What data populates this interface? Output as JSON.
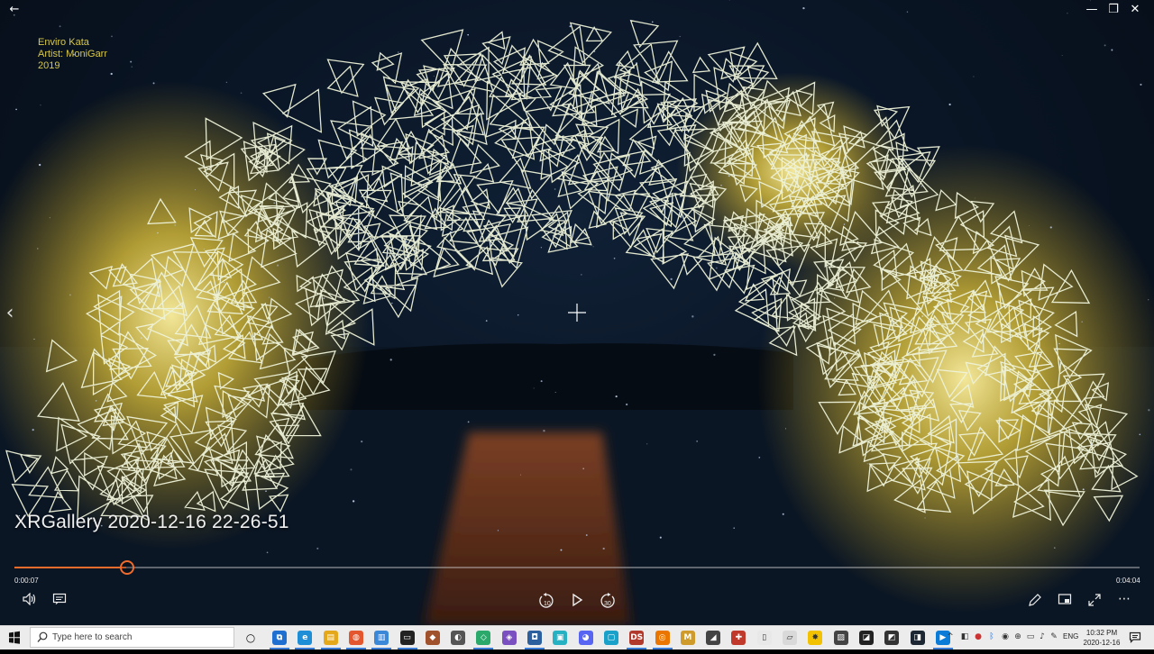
{
  "window": {
    "back_glyph": "←",
    "minimize_glyph": "—",
    "maximize_glyph": "❐",
    "close_glyph": "✕"
  },
  "viewer": {
    "side_prev_glyph": "‹",
    "watermark": [
      "Enviro Kata",
      "Artist: MoniGarr",
      "2019"
    ],
    "title": "XRGallery 2020-12-16 22-26-51",
    "time_elapsed": "0:00:07",
    "time_total": "0:04:04",
    "progress_fraction": 0.099,
    "accent": "#ef6c2c",
    "skip_back_label": "10",
    "skip_forward_label": "30"
  },
  "taskbar": {
    "search_placeholder": "Type here to search",
    "pinned_icons": [
      "task-view-icon",
      "edge-icon",
      "file-explorer-icon",
      "firefox-icon",
      "notes-icon",
      "oculus-icon",
      "game-icon",
      "sphere-app-icon",
      "app-icon",
      "app-icon",
      "visual-studio-icon",
      "photos-icon",
      "discord-icon",
      "app-icon",
      "daz-studio-icon",
      "blender-icon",
      "maya-icon",
      "app-icon",
      "app-icon",
      "app-icon",
      "app-icon",
      "app-icon",
      "app-icon",
      "app-icon",
      "unity-icon",
      "app-icon",
      "movies-tv-icon"
    ],
    "language": "ENG",
    "time": "10:32 PM",
    "date": "2020-12-16"
  }
}
